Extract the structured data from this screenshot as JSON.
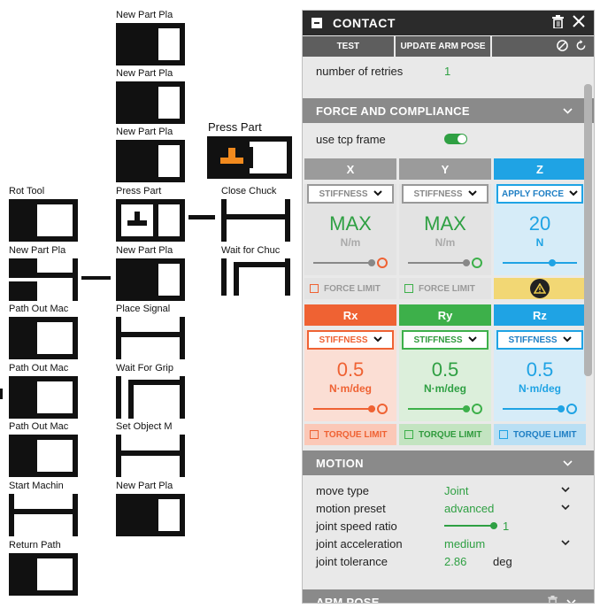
{
  "graph": {
    "column_a": [
      "Rot Tool",
      "New Part Pla",
      "Path Out Mac",
      "Path Out Mac",
      "Path Out Mac",
      "Start Machin",
      "Return Path"
    ],
    "column_b": [
      "New Part Pla",
      "New Part Pla",
      "New Part Pla",
      "Press Part",
      "New Part Pla",
      "Place Signal",
      "Wait For Grip",
      "Set Object M",
      "New Part Pla"
    ],
    "column_c": [
      "Close Chuck",
      "Wait for Chuc"
    ],
    "press_part_header": "Press Part"
  },
  "panel": {
    "title": "CONTACT",
    "title_icon": "contact-icon",
    "actions": {
      "test": "TEST",
      "update_arm_pose": "UPDATE ARM POSE"
    },
    "retries": {
      "label": "number of retries",
      "value": "1"
    },
    "force_section": {
      "title": "FORCE AND COMPLIANCE",
      "use_tcp_frame_label": "use tcp frame",
      "use_tcp_frame_on": true
    },
    "force_axes": [
      {
        "axis": "X",
        "mode": "STIFFNESS",
        "value": "MAX",
        "unit": "N/m",
        "limit": "FORCE LIMIT",
        "level": 0.9
      },
      {
        "axis": "Y",
        "mode": "STIFFNESS",
        "value": "MAX",
        "unit": "N/m",
        "limit": "FORCE LIMIT",
        "level": 0.9
      },
      {
        "axis": "Z",
        "mode": "APPLY FORCE",
        "value": "20",
        "unit": "N",
        "limit": "",
        "level": 0.65
      }
    ],
    "torque_axes": [
      {
        "axis": "Rx",
        "mode": "STIFFNESS",
        "value": "0.5",
        "unit": "N·m/deg",
        "limit": "TORQUE LIMIT",
        "level": 0.9
      },
      {
        "axis": "Ry",
        "mode": "STIFFNESS",
        "value": "0.5",
        "unit": "N·m/deg",
        "limit": "TORQUE LIMIT",
        "level": 0.9
      },
      {
        "axis": "Rz",
        "mode": "STIFFNESS",
        "value": "0.5",
        "unit": "N·m/deg",
        "limit": "TORQUE LIMIT",
        "level": 0.9
      }
    ],
    "motion": {
      "title": "MOTION",
      "rows": [
        {
          "label": "move type",
          "value": "Joint"
        },
        {
          "label": "motion preset",
          "value": "advanced"
        },
        {
          "label": "joint speed ratio",
          "value": "1",
          "level": 1.0
        },
        {
          "label": "joint acceleration",
          "value": "medium"
        },
        {
          "label": "joint tolerance",
          "value": "2.86",
          "unit": "deg"
        }
      ]
    },
    "arm_pose": {
      "title": "ARM POSE"
    },
    "colors": {
      "x_axis": "#9b9b9b",
      "y_axis": "#9b9b9b",
      "z_axis": "#1fa3e4",
      "rx_axis": "#ef6233",
      "ry_axis": "#3db04a",
      "rz_axis": "#1fa3e4",
      "value_green": "#2fa043",
      "warning": "#f2d774"
    }
  }
}
